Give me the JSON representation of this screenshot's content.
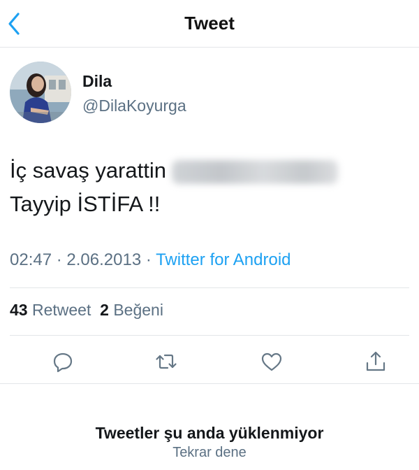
{
  "header": {
    "title": "Tweet",
    "back_icon": "chevron-left-icon",
    "accent": "#1da1f2"
  },
  "tweet": {
    "author": {
      "display_name": "Dila",
      "handle": "@DilaKoyurga"
    },
    "text_line1": "İç savaş yarattin",
    "text_line2": "Tayyip İSTİFA !!",
    "time": "02:47",
    "separator": "·",
    "date": "2.06.2013",
    "source": "Twitter for Android",
    "retweet_count": "43",
    "retweet_label": "Retweet",
    "like_count": "2",
    "like_label": "Beğeni"
  },
  "actions": {
    "reply_icon": "reply-icon",
    "retweet_icon": "retweet-icon",
    "like_icon": "heart-icon",
    "share_icon": "share-icon"
  },
  "replies": {
    "message": "Tweetler şu anda yüklenmiyor",
    "retry_label": "Tekrar dene"
  }
}
